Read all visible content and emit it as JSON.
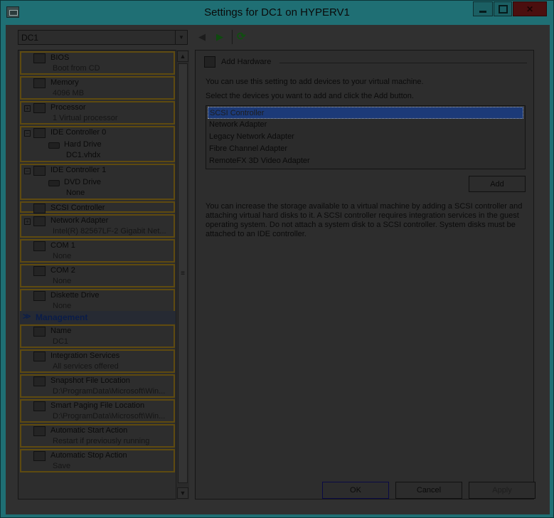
{
  "window": {
    "title": "Settings for DC1 on HYPERV1"
  },
  "vm_selector": {
    "value": "DC1"
  },
  "hardware": [
    {
      "name": "BIOS",
      "sub": "Boot from CD",
      "icon": "bios-icon"
    },
    {
      "name": "Memory",
      "sub": "4096 MB",
      "icon": "memory-icon"
    },
    {
      "name": "Processor",
      "sub": "1 Virtual processor",
      "icon": "processor-icon",
      "expandable": true
    },
    {
      "name": "IDE Controller 0",
      "icon": "ide-controller-icon",
      "expandable": true,
      "child": {
        "name": "Hard Drive",
        "sub": "DC1.vhdx",
        "icon": "hard-drive-icon"
      }
    },
    {
      "name": "IDE Controller 1",
      "icon": "ide-controller-icon",
      "expandable": true,
      "child": {
        "name": "DVD Drive",
        "sub": "None",
        "icon": "dvd-drive-icon"
      }
    },
    {
      "name": "SCSI Controller",
      "icon": "scsi-controller-icon"
    },
    {
      "name": "Network Adapter",
      "sub": "Intel(R) 82567LF-2 Gigabit Net...",
      "icon": "network-adapter-icon",
      "expandable": true
    },
    {
      "name": "COM 1",
      "sub": "None",
      "icon": "com-port-icon"
    },
    {
      "name": "COM 2",
      "sub": "None",
      "icon": "com-port-icon"
    },
    {
      "name": "Diskette Drive",
      "sub": "None",
      "icon": "diskette-drive-icon"
    }
  ],
  "management_header": "Management",
  "management": [
    {
      "name": "Name",
      "sub": "DC1",
      "icon": "name-icon"
    },
    {
      "name": "Integration Services",
      "sub": "All services offered",
      "icon": "integration-services-icon"
    },
    {
      "name": "Snapshot File Location",
      "sub": "D:\\ProgramData\\Microsoft\\Win...",
      "icon": "snapshot-icon"
    },
    {
      "name": "Smart Paging File Location",
      "sub": "D:\\ProgramData\\Microsoft\\Win...",
      "icon": "smart-paging-icon"
    },
    {
      "name": "Automatic Start Action",
      "sub": "Restart if previously running",
      "icon": "start-action-icon"
    },
    {
      "name": "Automatic Stop Action",
      "sub": "Save",
      "icon": "stop-action-icon"
    }
  ],
  "right": {
    "section_title": "Add Hardware",
    "intro": "You can use this setting to add devices to your virtual machine.",
    "instruction": "Select the devices you want to add and click the Add button.",
    "devices": [
      "SCSI Controller",
      "Network Adapter",
      "Legacy Network Adapter",
      "Fibre Channel Adapter",
      "RemoteFX 3D Video Adapter"
    ],
    "selected_device": "SCSI Controller",
    "add_label": "Add",
    "info": "You can increase the storage available to a virtual machine by adding a SCSI controller and attaching virtual hard disks to it. A SCSI controller requires integration services in the guest operating system. Do not attach a system disk to a SCSI controller. System disks must be attached to an IDE controller."
  },
  "buttons": {
    "ok": "OK",
    "cancel": "Cancel",
    "apply": "Apply"
  },
  "colors": {
    "titlebar": "#1f6f74",
    "selection": "#1c3a78",
    "item_border": "#5e4a10"
  }
}
